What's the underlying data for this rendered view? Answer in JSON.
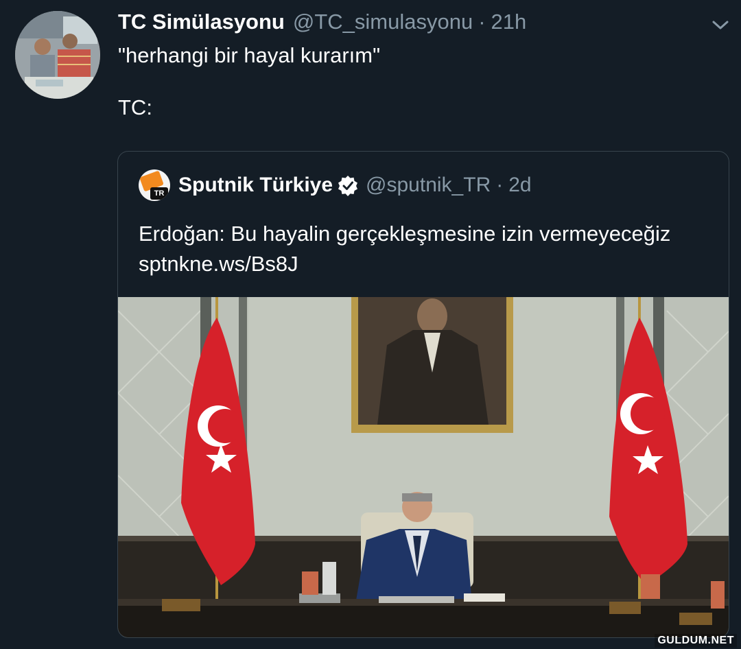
{
  "tweet": {
    "author": {
      "display_name": "TC Simülasyonu",
      "handle": "@TC_simulasyonu",
      "avatar_icon": "avatar-photo"
    },
    "time": "21h",
    "separator": "·",
    "text": "\"herhangi bir hayal kurarım\"\n\nTC:",
    "menu_icon": "chevron-down-icon"
  },
  "quoted_tweet": {
    "author": {
      "display_name": "Sputnik Türkiye",
      "handle": "@sputnik_TR",
      "verified": true,
      "logo_text": "TR"
    },
    "time": "2d",
    "separator": "·",
    "text": "Erdoğan: Bu hayalin gerçekleşmesine izin vermeyeceğiz sptnkne.ws/Bs8J",
    "image": "meeting-room-photo"
  },
  "watermark": "GULDUM.NET",
  "colors": {
    "background": "#141d26",
    "secondary_text": "#8899a6",
    "border": "#38444d",
    "flag_red": "#d6212a"
  }
}
